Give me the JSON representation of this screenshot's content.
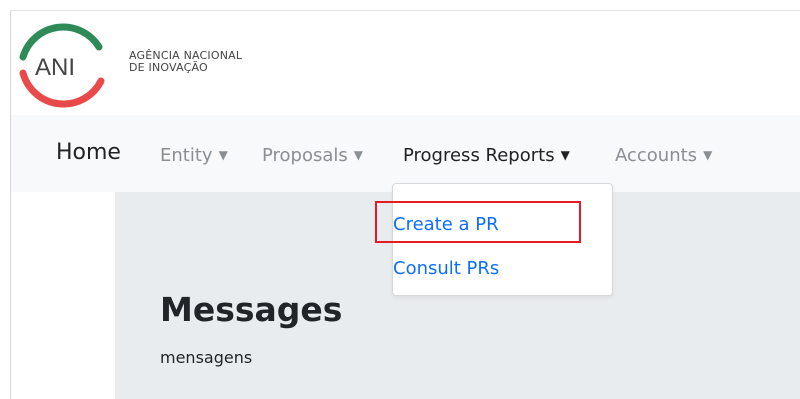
{
  "header": {
    "logo_text": "ANI",
    "org_name_line1": "AGÊNCIA NACIONAL",
    "org_name_line2": "DE INOVAÇÃO"
  },
  "nav": {
    "home": "Home",
    "items": [
      {
        "label": "Entity",
        "has_caret": true
      },
      {
        "label": "Proposals",
        "has_caret": true
      },
      {
        "label": "Progress Reports",
        "has_caret": true,
        "active": true
      },
      {
        "label": "Accounts",
        "has_caret": true
      }
    ],
    "caret": "▼"
  },
  "dropdown": {
    "items": [
      {
        "label": "Create a PR"
      },
      {
        "label": "Consult PRs"
      }
    ]
  },
  "content": {
    "title": "Messages",
    "subtitle": "mensagens"
  },
  "colors": {
    "link": "#0d6efd",
    "highlight": "#e51c23",
    "logo_green": "#2e8b57",
    "logo_red": "#e84a4a"
  }
}
